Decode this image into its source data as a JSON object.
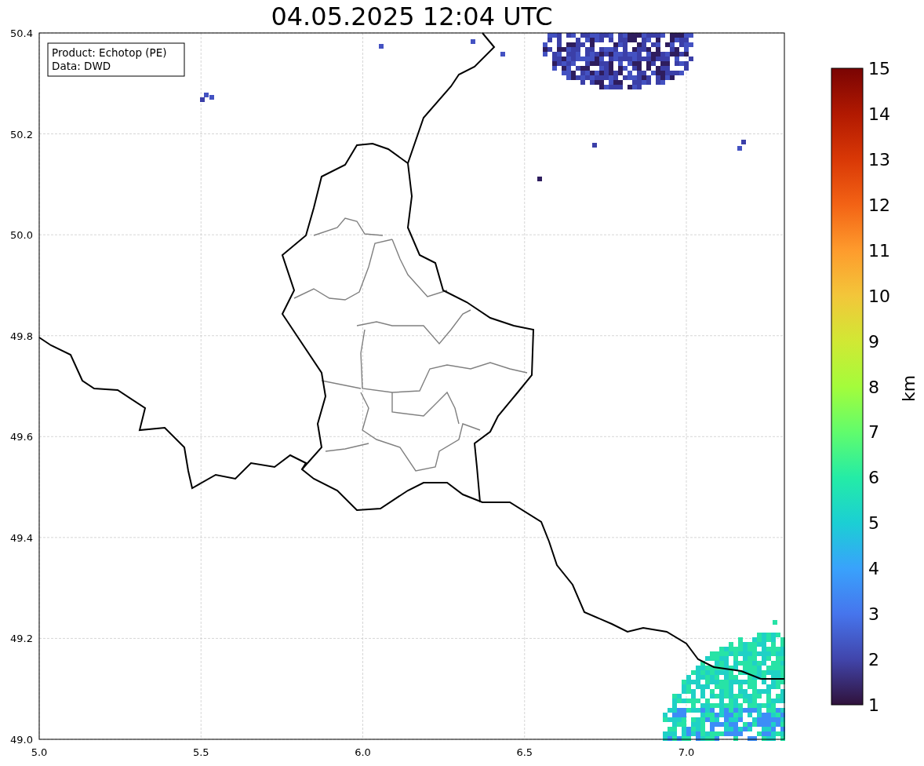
{
  "title": "04.05.2025 12:04 UTC",
  "legend": [
    "Product: Echotop (PE)",
    "Data: DWD"
  ],
  "axes": {
    "xticks": [
      "5.0",
      "5.5",
      "6.0",
      "6.5",
      "7.0"
    ],
    "yticks": [
      "50.4",
      "50.2",
      "50.0",
      "49.8",
      "49.6",
      "49.4",
      "49.2",
      "49.0"
    ]
  },
  "colorbar": {
    "label": "km",
    "ticks": [
      "15",
      "14",
      "13",
      "12",
      "11",
      "10",
      "9",
      "8",
      "7",
      "6",
      "5",
      "4",
      "3",
      "2",
      "1"
    ]
  }
}
